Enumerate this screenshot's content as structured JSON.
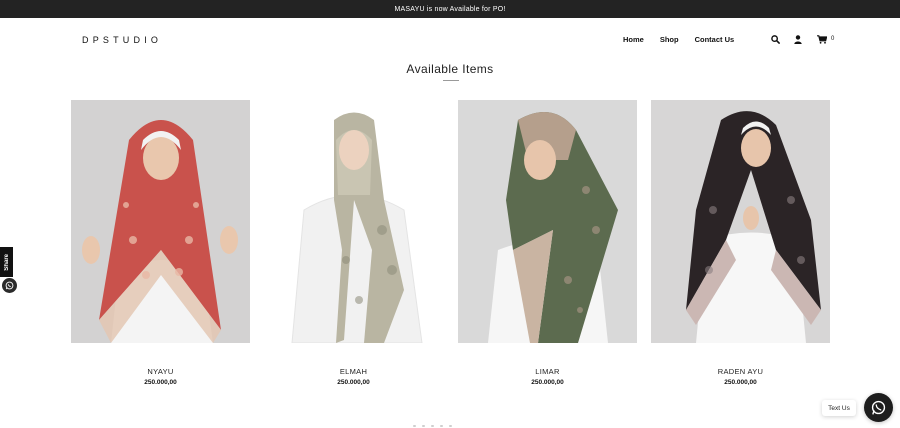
{
  "announcement": {
    "text": "MASAYU is now Available for PO!"
  },
  "header": {
    "logo": "DPSTUDIO",
    "nav": [
      {
        "label": "Home"
      },
      {
        "label": "Shop"
      },
      {
        "label": "Contact Us"
      }
    ],
    "icons": {
      "search": "search-icon",
      "account": "user-icon",
      "cart": "cart-icon"
    },
    "cart_count": "0"
  },
  "section": {
    "title": "Available Items"
  },
  "products": [
    {
      "name": "NYAYU",
      "price": "250.000,00",
      "scarf_color": "#c9524c"
    },
    {
      "name": "ELMAH",
      "price": "250.000,00",
      "scarf_color": "#b9b5a2"
    },
    {
      "name": "LIMAR",
      "price": "250.000,00",
      "scarf_color": "#5c6b4f"
    },
    {
      "name": "RADEN AYU",
      "price": "250.000,00",
      "scarf_color": "#2b2426"
    }
  ],
  "share": {
    "label": "Share",
    "icon": "whatsapp-icon"
  },
  "chat": {
    "label": "Text Us",
    "icon": "whatsapp-icon"
  },
  "colors": {
    "announcement_bg": "#232323",
    "chat_button_bg": "#1d1d1d"
  }
}
